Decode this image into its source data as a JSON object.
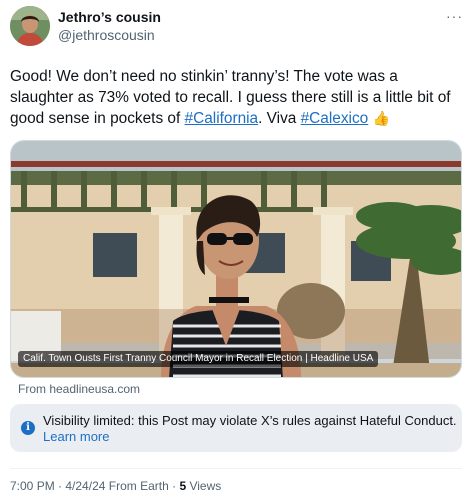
{
  "author": {
    "display_name": "Jethro’s cousin",
    "handle": "@jethroscousin",
    "more_label": "···"
  },
  "post": {
    "text_1": "Good! We don’t need no stinkin’ tranny’s! The vote was a slaughter as 73% voted to recall. I guess there still is a little bit of good sense in pockets of ",
    "hashtag_1": "#California",
    "text_2": ". Viva ",
    "hashtag_2": "#Calexico",
    "emoji": "👍",
    "link_color": "#1d6fc4"
  },
  "media": {
    "caption": "Calif. Town Ousts First Tranny Council Mayor in Recall Election | Headline USA",
    "source": "From headlineusa.com"
  },
  "notice": {
    "icon": "info-icon",
    "icon_glyph": "i",
    "text": "Visibility limited: this Post may violate X’s rules against Hateful Conduct.",
    "link": "Learn more",
    "background": "#eaeef3"
  },
  "meta": {
    "time": "7:00 PM",
    "sep1": " · ",
    "date": "4/24/24",
    "location": " From Earth",
    "sep2": " · ",
    "views_count": "5",
    "views_label": " Views"
  }
}
